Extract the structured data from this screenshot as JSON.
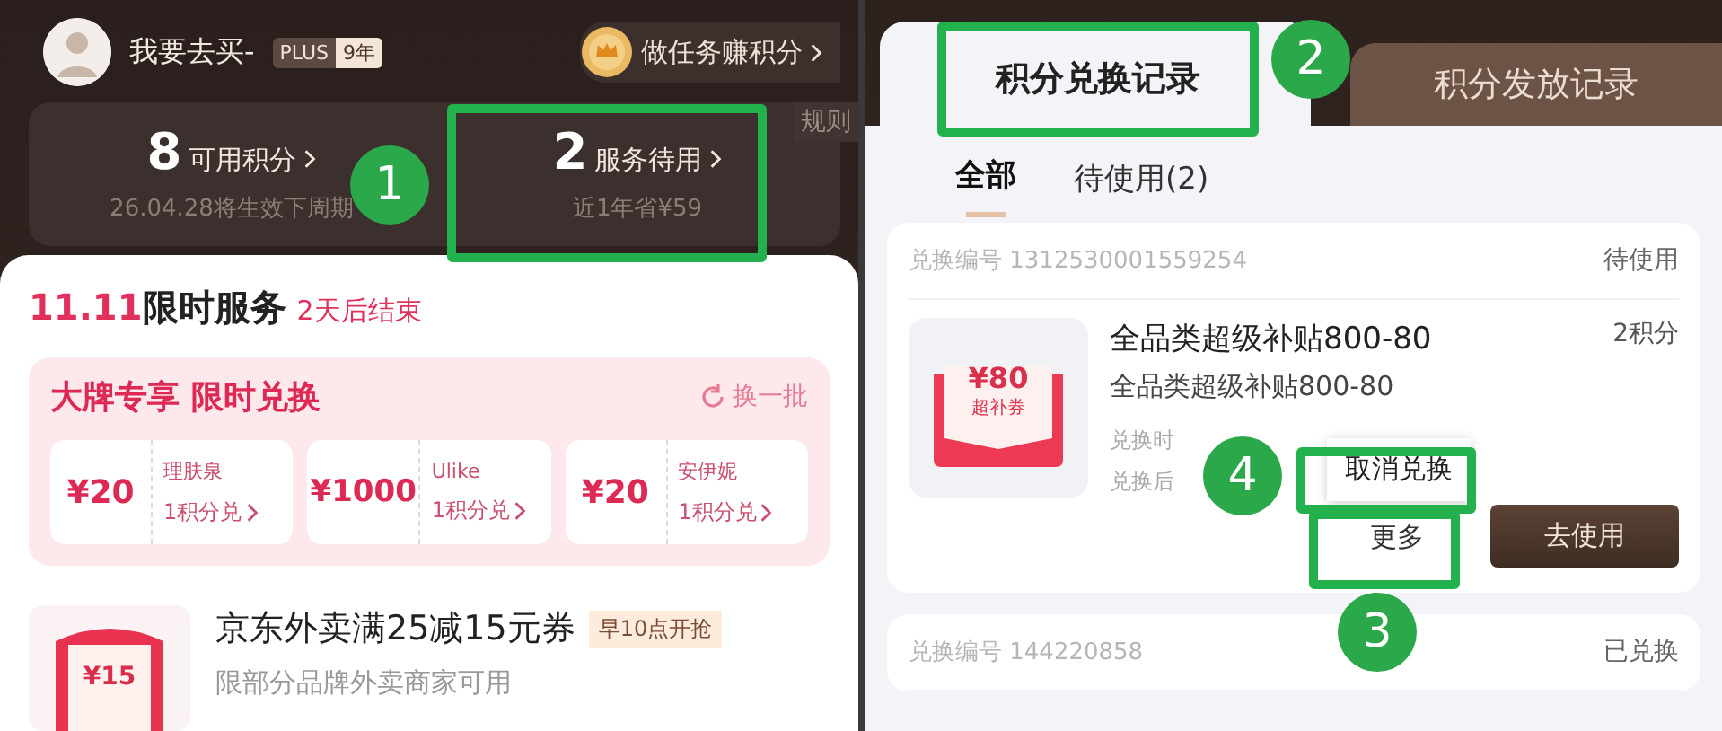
{
  "left": {
    "user": {
      "name": "我要去买-",
      "badge": "PLUS",
      "years": "9年"
    },
    "task_link": "做任务赚积分",
    "rules_link": "规则",
    "stats": [
      {
        "value": "8",
        "label": "可用积分",
        "note": "26.04.28将生效下周期"
      },
      {
        "value": "2",
        "label": "服务待用",
        "note": "近1年省¥59"
      }
    ],
    "promo": {
      "highlight": "11.11",
      "title": "限时服务",
      "countdown": "2天后结束"
    },
    "brand_card": {
      "title": "大牌专享 限时兑换",
      "refresh": "换一批",
      "coupons": [
        {
          "amount": "¥20",
          "brand": "理肤泉",
          "price": "1积分兑"
        },
        {
          "amount": "¥1000",
          "brand": "Ulike",
          "price": "1积分兑"
        },
        {
          "amount": "¥20",
          "brand": "安伊妮",
          "price": "1积分兑"
        }
      ]
    },
    "offer": {
      "image_amount": "¥15",
      "title": "京东外卖满25减15元券",
      "tag": "早10点开抢",
      "subtitle": "限部分品牌外卖商家可用"
    }
  },
  "right": {
    "tabs": [
      {
        "label": "积分兑换记录",
        "selected": true
      },
      {
        "label": "积分发放记录",
        "selected": false
      }
    ],
    "filters": [
      {
        "label": "全部",
        "selected": true
      },
      {
        "label": "待使用(2)",
        "selected": false
      }
    ],
    "records": [
      {
        "number": "兑换编号 1312530001559254",
        "status": "待使用",
        "image": {
          "amount": "¥80",
          "caption": "超补券"
        },
        "title": "全品类超级补贴800-80",
        "points": "2积分",
        "subtitle": "全品类超级补贴800-80",
        "details": [
          "兑换时",
          "兑换后"
        ],
        "menu": [
          "取消兑换"
        ],
        "buttons": [
          {
            "label": "更多",
            "kind": "outline"
          },
          {
            "label": "去使用",
            "kind": "primary"
          }
        ]
      },
      {
        "number": "兑换编号 144220858",
        "status": "已兑换"
      }
    ]
  },
  "annotations": [
    {
      "number": "1"
    },
    {
      "number": "2"
    },
    {
      "number": "3"
    },
    {
      "number": "4"
    }
  ]
}
